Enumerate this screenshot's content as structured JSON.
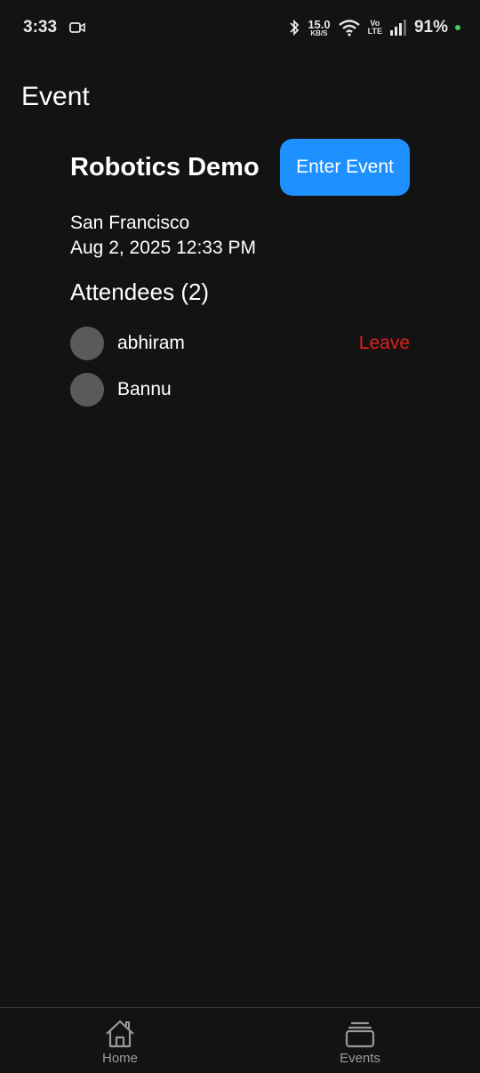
{
  "status_bar": {
    "time": "3:33",
    "net_speed": "15.0",
    "net_unit": "KB/S",
    "volte_top": "Vo",
    "volte_bottom": "LTE",
    "battery": "91%"
  },
  "header": {
    "title": "Event"
  },
  "event": {
    "name": "Robotics Demo",
    "enter_label": "Enter Event",
    "location": "San Francisco",
    "datetime": "Aug 2, 2025 12:33 PM",
    "attendees_heading": "Attendees (2)",
    "attendees": [
      {
        "name": "abhiram",
        "action": "Leave"
      },
      {
        "name": "Bannu"
      }
    ]
  },
  "nav": {
    "items": [
      {
        "label": "Home",
        "icon": "home-icon"
      },
      {
        "label": "Events",
        "icon": "events-stack-icon"
      }
    ]
  },
  "colors": {
    "background": "#131313",
    "accent": "#1e90ff",
    "danger": "#e0201c",
    "avatar": "#5a5a5a",
    "battery_dot": "#3ecf5a"
  }
}
